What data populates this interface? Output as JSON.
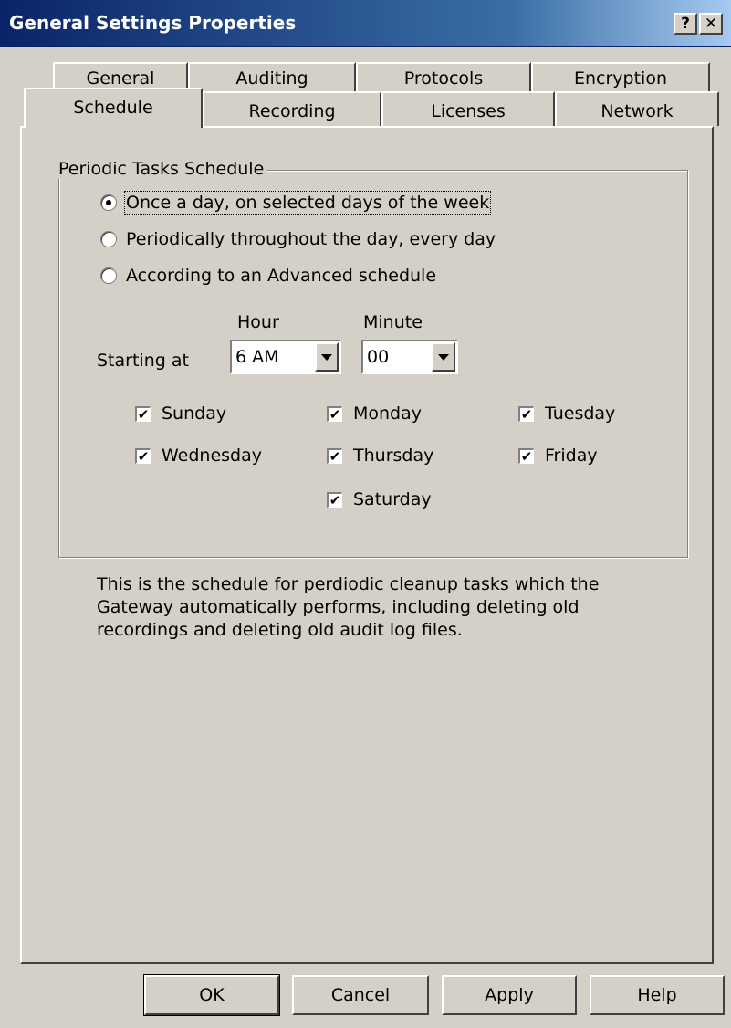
{
  "window": {
    "title": "General Settings Properties",
    "help_glyph": "?",
    "close_glyph": "✕"
  },
  "tabs": {
    "row1": [
      "General",
      "Auditing",
      "Protocols",
      "Encryption"
    ],
    "row2": [
      "Schedule",
      "Recording",
      "Licenses",
      "Network"
    ],
    "active": "Schedule"
  },
  "schedule": {
    "group_title": "Periodic Tasks Schedule",
    "options": [
      {
        "label": "Once a day, on selected days of the week",
        "selected": true
      },
      {
        "label": "Periodically throughout the day, every day",
        "selected": false
      },
      {
        "label": "According to an Advanced schedule",
        "selected": false
      }
    ],
    "hour_label": "Hour",
    "minute_label": "Minute",
    "starting_at_label": "Starting at",
    "hour_value": "6 AM",
    "minute_value": "00",
    "days": [
      {
        "label": "Sunday",
        "checked": true
      },
      {
        "label": "Monday",
        "checked": true
      },
      {
        "label": "Tuesday",
        "checked": true
      },
      {
        "label": "Wednesday",
        "checked": true
      },
      {
        "label": "Thursday",
        "checked": true
      },
      {
        "label": "Friday",
        "checked": true
      },
      {
        "label": "Saturday",
        "checked": true
      }
    ],
    "description": "This is the schedule for perdiodic cleanup tasks which the Gateway automatically performs, including deleting old recordings and deleting old audit log files."
  },
  "buttons": {
    "ok": "OK",
    "cancel": "Cancel",
    "apply": "Apply",
    "help": "Help"
  },
  "check_glyph": "✔"
}
